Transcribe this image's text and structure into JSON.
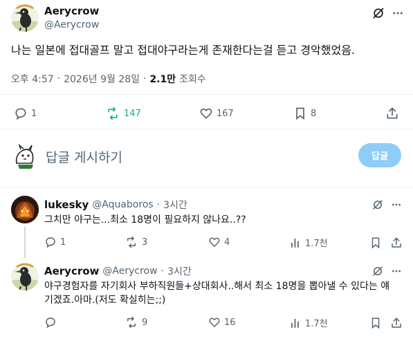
{
  "main_post": {
    "author_name": "Aerycrow",
    "author_handle": "@Aerycrow",
    "text": "나는 일본에 접대골프 말고 접대야구라는게 존재한다는걸 듣고 경악했었음.",
    "time": "오후 4:57",
    "date": "2026년 9월 28일",
    "views_count": "2.1만",
    "views_label": "조회수",
    "replies": "1",
    "reposts": "147",
    "likes": "167",
    "bookmarks": "8"
  },
  "composer": {
    "placeholder": "답글 게시하기",
    "button_label": "답글"
  },
  "replies": [
    {
      "author_name": "lukesky",
      "author_handle": "@Aquaboros",
      "time": "3시간",
      "text": "그치만 야구는...최소 18명이 필요하지 않나요..??",
      "replies": "1",
      "reposts": "3",
      "likes": "4",
      "views": "1.7천"
    },
    {
      "author_name": "Aerycrow",
      "author_handle": "@Aerycrow",
      "time": "3시간",
      "text_line1": "야구경험자를 자기회사 부하직원들+상대회사..해서 최소 18명을 뽑아낼 수 있다는 얘",
      "text_line2": "기겠죠.아마.(저도 확실히는;;)",
      "replies": "",
      "reposts": "9",
      "likes": "16",
      "views": "1.7천"
    }
  ],
  "dot": "·",
  "colors": {
    "text_primary": "#0f1419",
    "text_secondary": "#536471",
    "repost_active": "#00ba7c",
    "reply_button": "#8ecdf8",
    "divider": "#eff3f4"
  }
}
